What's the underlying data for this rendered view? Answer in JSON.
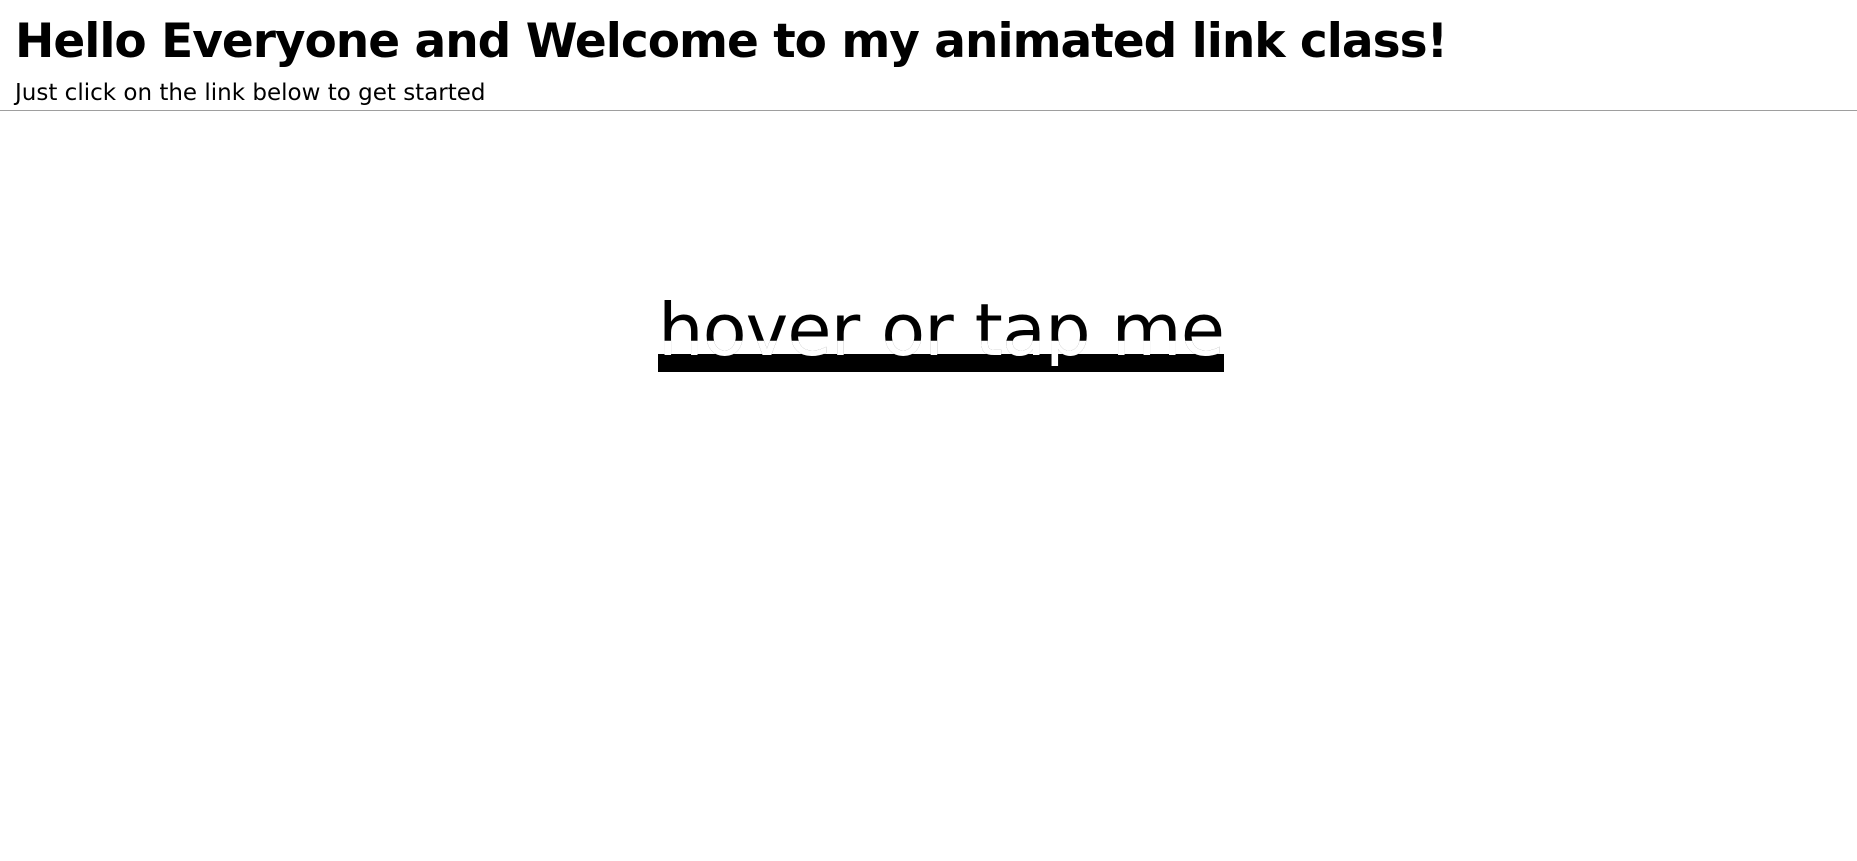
{
  "header": {
    "title": "Hello Everyone and Welcome to my animated link class!",
    "subtitle": "Just click on the link below to get started"
  },
  "main": {
    "link_label": "hover or tap me"
  },
  "colors": {
    "background": "#ffffff",
    "text": "#000000",
    "divider": "#9e9e9e",
    "underline": "#000000"
  }
}
